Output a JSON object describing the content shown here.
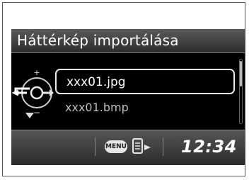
{
  "header": {
    "title": "Háttérkép importálása"
  },
  "file_list": {
    "items": [
      {
        "label": "xxx01.jpg",
        "selected": true
      },
      {
        "label": "xxx01.bmp",
        "selected": false
      }
    ]
  },
  "controller": {
    "up_symbol": "+",
    "down_symbol": "−",
    "icon": "rotary-knob-icon",
    "back_icon": "back-arrow-icon"
  },
  "footer": {
    "menu_label": "MENU",
    "menu_icon": "menu-button-icon",
    "import_icon": "import-icon",
    "clock": "12:34"
  },
  "colors": {
    "screen_background": "#000000",
    "text": "#ffffff",
    "secondary_text": "#bdbdbd",
    "bar": "#3c3c3c"
  }
}
